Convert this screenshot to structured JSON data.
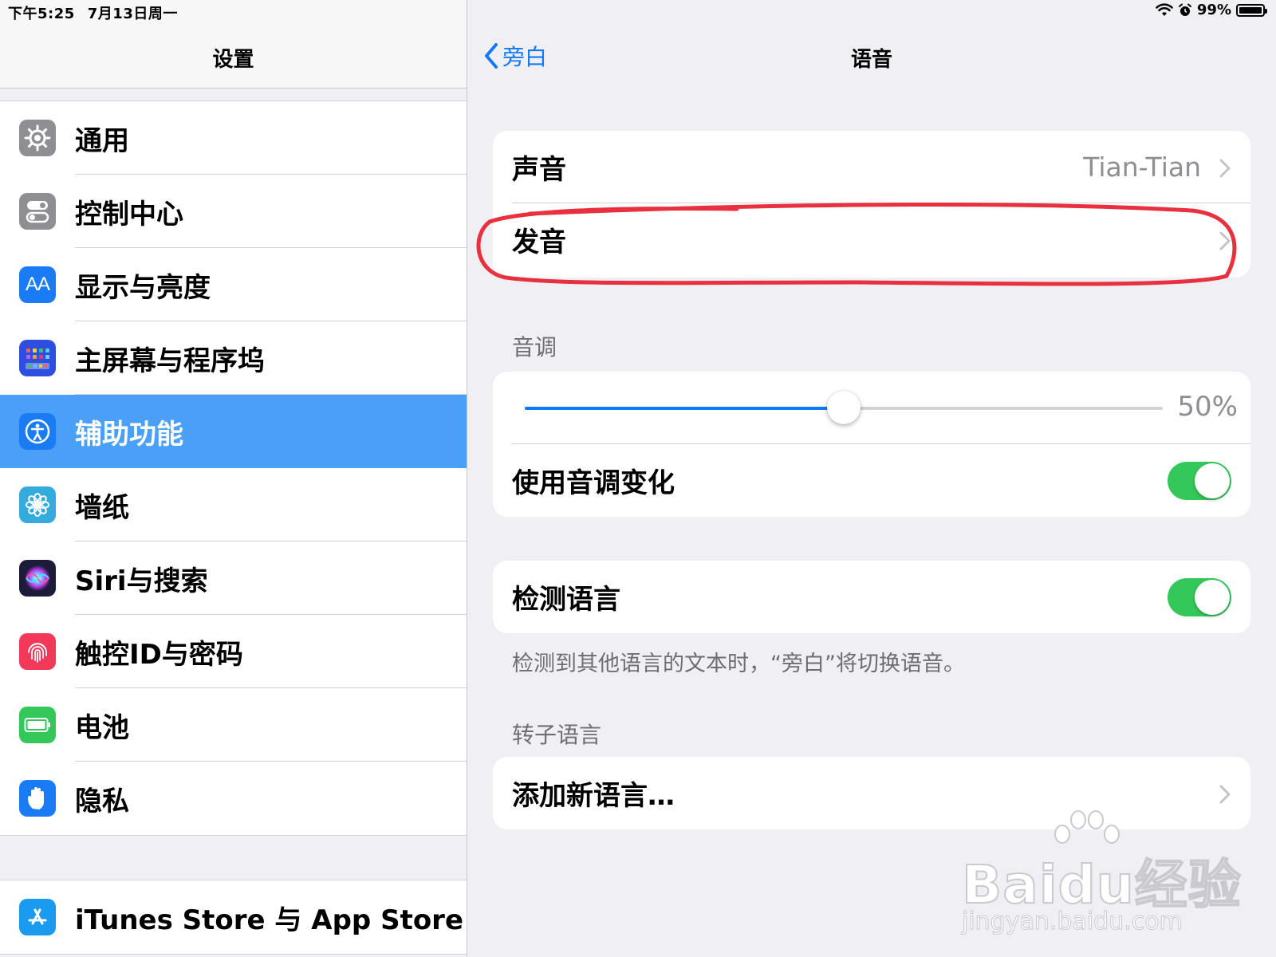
{
  "status_bar": {
    "time": "下午5:25",
    "date": "7月13日周一",
    "battery_percent": "99%"
  },
  "sidebar": {
    "title": "设置",
    "items": [
      {
        "label": "通用",
        "icon": "gear-icon",
        "color": "#8e8e93"
      },
      {
        "label": "控制中心",
        "icon": "toggle-switches-icon",
        "color": "#8e8e93"
      },
      {
        "label": "显示与亮度",
        "icon": "text-size-icon",
        "icon_text": "AA",
        "color": "#1a7cf5"
      },
      {
        "label": "主屏幕与程序坞",
        "icon": "app-grid-icon",
        "color": "#2e4ee0"
      },
      {
        "label": "辅助功能",
        "icon": "accessibility-icon",
        "color": "#1a7cf5",
        "selected": true
      },
      {
        "label": "墙纸",
        "icon": "flower-icon",
        "color": "#35aadc"
      },
      {
        "label": "Siri与搜索",
        "icon": "siri-icon",
        "color": "#1c1c3a"
      },
      {
        "label": "触控ID与密码",
        "icon": "fingerprint-icon",
        "color": "#f2395a"
      },
      {
        "label": "电池",
        "icon": "battery-icon",
        "color": "#34c759"
      },
      {
        "label": "隐私",
        "icon": "hand-icon",
        "color": "#1a7cf5"
      }
    ],
    "store_item": {
      "label": "iTunes Store 与 App Store",
      "icon": "app-store-icon",
      "color": "#1a9bf0"
    }
  },
  "detail": {
    "back_label": "旁白",
    "title": "语音",
    "voice": {
      "label": "声音",
      "value": "Tian-Tian"
    },
    "pronunciation": {
      "label": "发音"
    },
    "pitch": {
      "section_label": "音调",
      "value_text": "50%",
      "level": 0.5
    },
    "pitch_change": {
      "label": "使用音调变化",
      "on": true
    },
    "detect_language": {
      "label": "检测语言",
      "on": true
    },
    "detect_footnote": "检测到其他语言的文本时，“旁白”将切换语音。",
    "rotor_section_label": "转子语言",
    "add_language": {
      "label": "添加新语言…"
    }
  },
  "watermark": {
    "brand": "Baidu经验",
    "url": "jingyan.baidu.com"
  },
  "colors": {
    "accent": "#1479f5",
    "selected_row": "#4aa0f6",
    "toggle_on": "#34c759",
    "annotation": "#e8303f"
  }
}
